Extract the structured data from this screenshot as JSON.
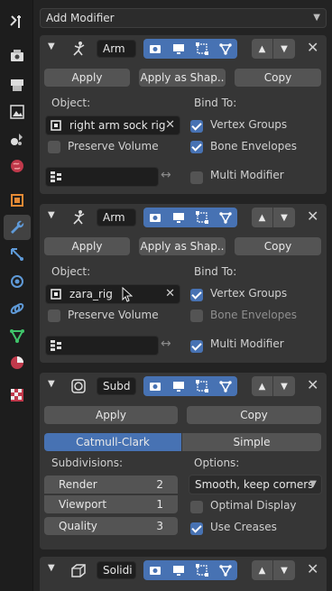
{
  "add_modifier": {
    "label": "Add Modifier"
  },
  "tabs": [
    {
      "icon": "tool-icon"
    },
    {
      "icon": "render-icon"
    },
    {
      "icon": "output-icon"
    },
    {
      "icon": "view-layer-icon"
    },
    {
      "icon": "scene-icon"
    },
    {
      "icon": "world-icon"
    },
    {
      "icon": "object-icon"
    },
    {
      "icon": "wrench-icon",
      "active": true
    },
    {
      "icon": "particles-icon"
    },
    {
      "icon": "physics-icon"
    },
    {
      "icon": "constraints-icon"
    },
    {
      "icon": "object-data-icon"
    },
    {
      "icon": "material-icon"
    },
    {
      "icon": "texture-icon"
    }
  ],
  "modifiers": [
    {
      "name": "Arm",
      "type_icon": "armature-modifier-icon",
      "apply_label": "Apply",
      "apply_shape_label": "Apply as Shap..",
      "copy_label": "Copy",
      "object_label": "Object:",
      "object_value": "right arm sock rig",
      "bind_label": "Bind To:",
      "vertex_groups_label": "Vertex Groups",
      "vertex_groups": true,
      "preserve_volume_label": "Preserve Volume",
      "preserve_volume": false,
      "bone_envelopes_label": "Bone Envelopes",
      "bone_envelopes": true,
      "multi_modifier_label": "Multi Modifier",
      "multi_modifier": false
    },
    {
      "name": "Arm",
      "type_icon": "armature-modifier-icon",
      "apply_label": "Apply",
      "apply_shape_label": "Apply as Shap..",
      "copy_label": "Copy",
      "object_label": "Object:",
      "object_value": "zara_rig",
      "bind_label": "Bind To:",
      "vertex_groups_label": "Vertex Groups",
      "vertex_groups": true,
      "preserve_volume_label": "Preserve Volume",
      "preserve_volume": false,
      "bone_envelopes_label": "Bone Envelopes",
      "bone_envelopes": false,
      "multi_modifier_label": "Multi Modifier",
      "multi_modifier": true
    }
  ],
  "subd": {
    "name": "Subd",
    "type_icon": "subdivision-modifier-icon",
    "apply_label": "Apply",
    "copy_label": "Copy",
    "mode_catmull": "Catmull-Clark",
    "mode_simple": "Simple",
    "active_mode": "Catmull-Clark",
    "subdivisions_label": "Subdivisions:",
    "render_label": "Render",
    "render_value": "2",
    "viewport_label": "Viewport",
    "viewport_value": "1",
    "quality_label": "Quality",
    "quality_value": "3",
    "options_label": "Options:",
    "uv_smooth": "Smooth, keep corners",
    "optimal_display_label": "Optimal Display",
    "optimal_display": false,
    "use_creases_label": "Use Creases",
    "use_creases": true
  },
  "solidify": {
    "name": "Solidi",
    "type_icon": "solidify-modifier-icon"
  },
  "colors": {
    "accent": "#4772b3",
    "panel": "#363636",
    "field": "#1e1e1e",
    "button": "#545454"
  }
}
